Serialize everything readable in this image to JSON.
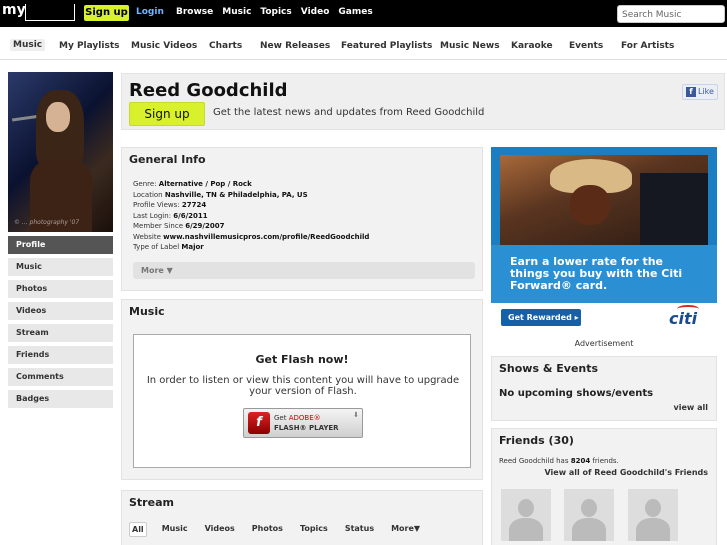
{
  "topbar": {
    "logo": "my",
    "signup": "Sign up",
    "login": "Login",
    "nav": [
      "Browse",
      "Music",
      "Topics",
      "Video",
      "Games"
    ],
    "search_placeholder": "Search Music"
  },
  "subnav": {
    "items": [
      "Music",
      "My Playlists",
      "Music Videos",
      "Charts",
      "New Releases",
      "Featured Playlists",
      "Music News",
      "Karaoke",
      "Events",
      "For Artists"
    ],
    "active": "Music"
  },
  "profile": {
    "photo_credit": "© ... photography '07",
    "nav": [
      "Profile",
      "Music",
      "Photos",
      "Videos",
      "Stream",
      "Friends",
      "Comments",
      "Badges"
    ],
    "active_nav": "Profile"
  },
  "header": {
    "artist_name": "Reed Goodchild",
    "signup_button": "Sign up",
    "subtitle": "Get the latest news and updates from Reed Goodchild",
    "like_label": "Like"
  },
  "general_info": {
    "title": "General Info",
    "rows": [
      {
        "label": "Genre:",
        "value": "Alternative / Pop / Rock"
      },
      {
        "label": "Location",
        "value": "Nashville, TN & Philadelphia, PA, US"
      },
      {
        "label": "Profile Views:",
        "value": "27724"
      },
      {
        "label": "Last Login:",
        "value": "6/6/2011"
      },
      {
        "label": "Member Since",
        "value": "6/29/2007"
      },
      {
        "label": "Website",
        "value": "www.nashvillemusicpros.com/profile/ReedGoodchild"
      },
      {
        "label": "Type of Label",
        "value": "Major"
      }
    ],
    "more": "More ▼"
  },
  "music": {
    "title": "Music",
    "flash_title": "Get Flash now!",
    "flash_text": "In order to listen or view this content you will have to upgrade your version of Flash.",
    "flash_btn_line1_pre": "Get ",
    "flash_btn_line1_adobe": "ADOBE®",
    "flash_btn_line2": "FLASH® PLAYER"
  },
  "stream": {
    "title": "Stream",
    "tabs": [
      "All",
      "Music",
      "Videos",
      "Photos",
      "Topics",
      "Status",
      "More▼"
    ],
    "active": "All"
  },
  "ad": {
    "headline": "Earn a lower rate for the things you buy with the Citi Forward® card.",
    "button": "Get Rewarded ▸",
    "logo": "citi",
    "caption": "Advertisement"
  },
  "shows": {
    "title": "Shows & Events",
    "empty": "No upcoming shows/events",
    "view_all": "view all"
  },
  "friends": {
    "title": "Friends (30)",
    "line1_pre": "Reed Goodchild has ",
    "line1_count": "8204",
    "line1_post": " friends.",
    "view_all": "View all of Reed Goodchild's Friends"
  },
  "colors": {
    "accent_signup": "#d9f02c",
    "topbar": "#000000",
    "link_login": "#6fb6ff",
    "ad_blue": "#2a8fd3"
  }
}
